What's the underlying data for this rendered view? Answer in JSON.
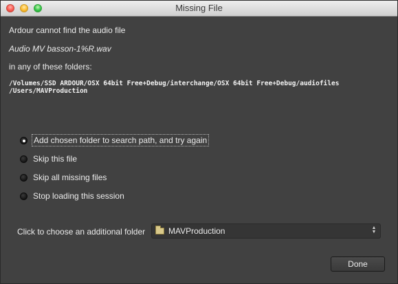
{
  "window": {
    "title": "Missing File"
  },
  "message": {
    "line1": "Ardour cannot find the audio file",
    "filename": "Audio MV basson-1%R.wav",
    "line2": "in any of these folders:",
    "paths": [
      "/Volumes/SSD ARDOUR/OSX 64bit Free+Debug/interchange/OSX 64bit Free+Debug/audiofiles",
      "/Users/MAVProduction"
    ]
  },
  "options": [
    {
      "label": "Add chosen folder to search path, and try again",
      "checked": true
    },
    {
      "label": "Skip this file",
      "checked": false
    },
    {
      "label": "Skip all missing files",
      "checked": false
    },
    {
      "label": "Stop loading this session",
      "checked": false
    }
  ],
  "folder": {
    "label": "Click to choose an additional folder",
    "value": "MAVProduction",
    "icon": "folder-icon"
  },
  "buttons": {
    "done": "Done"
  }
}
